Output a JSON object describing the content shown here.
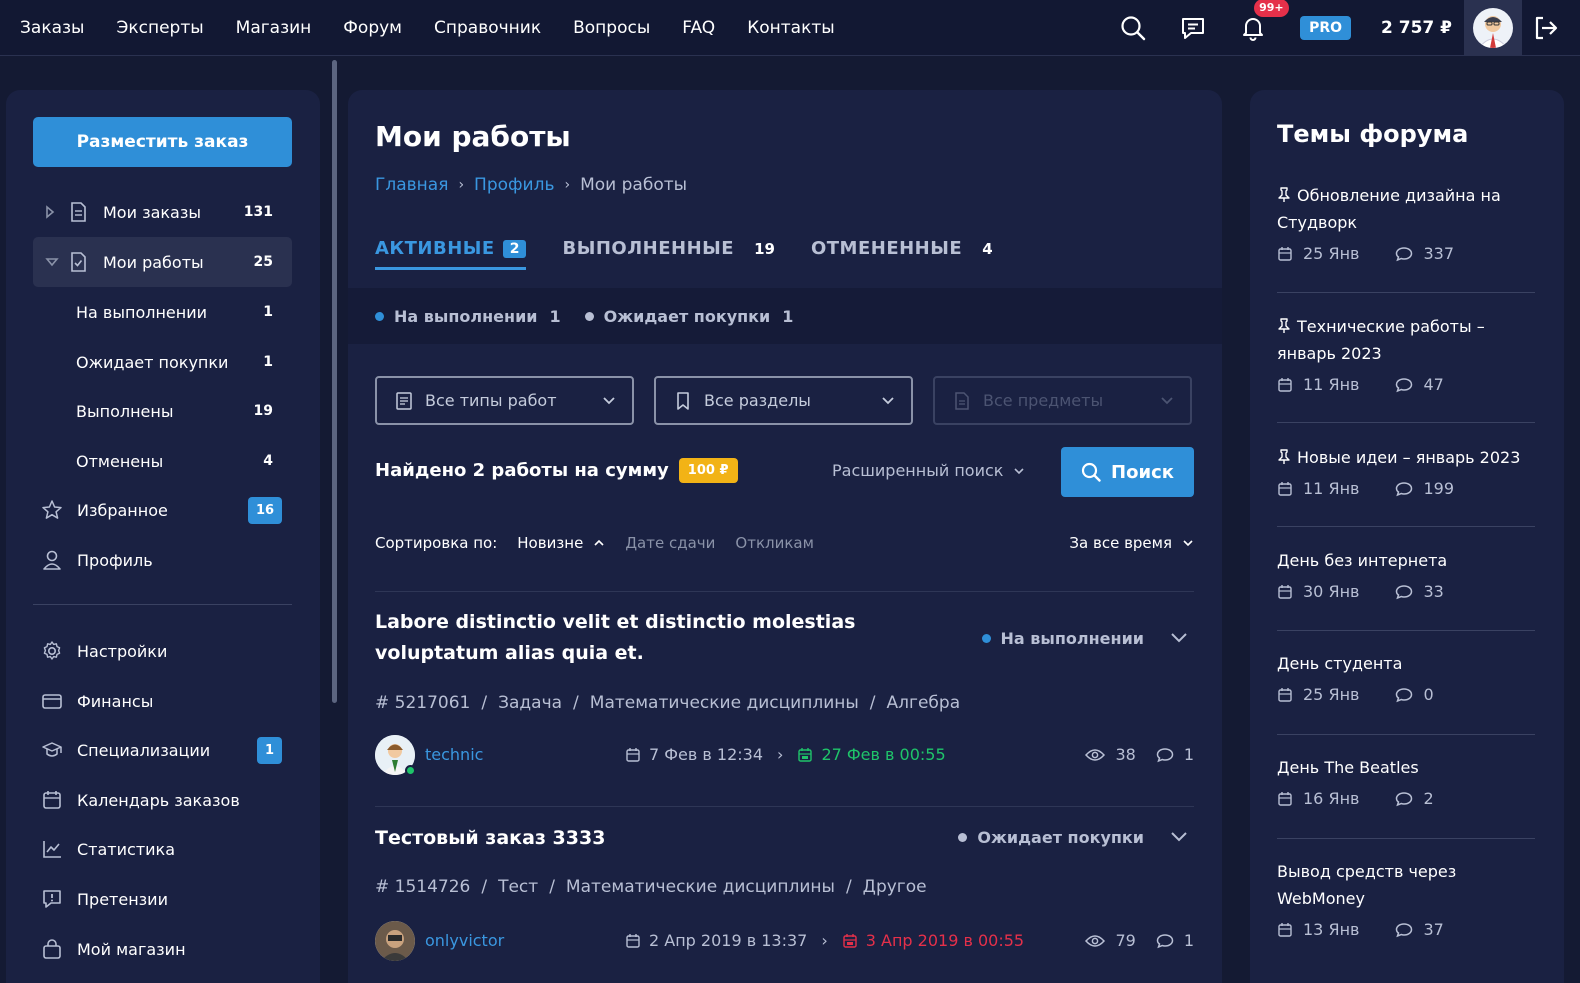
{
  "topbar": {
    "nav": [
      "Заказы",
      "Эксперты",
      "Магазин",
      "Форум",
      "Справочник",
      "Вопросы",
      "FAQ",
      "Контакты"
    ],
    "notifications_badge": "99+",
    "pro_label": "PRO",
    "balance": "2 757 ₽",
    "icons": [
      "search-icon",
      "chat-icon",
      "bell-icon",
      "avatar",
      "logout-icon"
    ]
  },
  "sidebar": {
    "post_button": "Разместить заказ",
    "items": [
      {
        "label": "Мои заказы",
        "count": "131"
      },
      {
        "label": "Мои работы",
        "count": "25"
      },
      {
        "label": "На выполнении",
        "count": "1"
      },
      {
        "label": "Ожидает покупки",
        "count": "1"
      },
      {
        "label": "Выполнены",
        "count": "19"
      },
      {
        "label": "Отменены",
        "count": "4"
      },
      {
        "label": "Избранное",
        "count": "16"
      },
      {
        "label": "Профиль",
        "count": ""
      },
      {
        "label": "Настройки",
        "count": ""
      },
      {
        "label": "Финансы",
        "count": ""
      },
      {
        "label": "Специализации",
        "count": "1"
      },
      {
        "label": "Календарь заказов",
        "count": ""
      },
      {
        "label": "Статистика",
        "count": ""
      },
      {
        "label": "Претензии",
        "count": ""
      },
      {
        "label": "Мой магазин",
        "count": ""
      }
    ]
  },
  "main": {
    "title": "Мои работы",
    "breadcrumb": [
      "Главная",
      "Профиль",
      "Мои работы"
    ],
    "tabs": [
      {
        "label": "АКТИВНЫЕ",
        "count": "2"
      },
      {
        "label": "ВЫПОЛНЕННЫЕ",
        "count": "19"
      },
      {
        "label": "ОТМЕНЕННЫЕ",
        "count": "4"
      }
    ],
    "status_filters": [
      {
        "label": "На выполнении",
        "count": "1",
        "color": "#2f8fd8"
      },
      {
        "label": "Ожидает покупки",
        "count": "1",
        "color": "#b8bfd4"
      }
    ],
    "filters": [
      "Все типы работ",
      "Все разделы",
      "Все предметы"
    ],
    "found_text": "Найдено 2 работы на сумму",
    "found_sum": "100 ₽",
    "advanced_search": "Расширенный поиск",
    "search_button": "Поиск",
    "sort_label": "Сортировка по:",
    "sort_options": [
      "Новизне",
      "Дате сдачи",
      "Откликам"
    ],
    "period": "За все время",
    "orders": [
      {
        "title": "Labore distinctio velit et distinctio molestias voluptatum alias quia et.",
        "status": "На выполнении",
        "status_color": "#2f8fd8",
        "id": "# 5217061",
        "type": "Задача",
        "section": "Математические дисциплины",
        "subject": "Алгебра",
        "user": "technic",
        "date_from": "7 Фев в 12:34",
        "date_to": "27 Фев в 00:55",
        "views": "38",
        "comments": "1"
      },
      {
        "title": "Тестовый заказ 3333",
        "status": "Ожидает покупки",
        "status_color": "#b8bfd4",
        "id": "# 1514726",
        "type": "Тест",
        "section": "Математические дисциплины",
        "subject": "Другое",
        "user": "onlyvictor",
        "date_from": "2 Апр 2019 в 13:37",
        "date_to": "3 Апр 2019 в 00:55",
        "views": "79",
        "comments": "1"
      }
    ]
  },
  "forum": {
    "title": "Темы форума",
    "topics": [
      {
        "title": "Обновление дизайна на Студворк",
        "date": "25 Янв",
        "comments": "337",
        "pinned": true
      },
      {
        "title": "Технические работы – январь 2023",
        "date": "11 Янв",
        "comments": "47",
        "pinned": true
      },
      {
        "title": "Новые идеи – январь 2023",
        "date": "11 Янв",
        "comments": "199",
        "pinned": true
      },
      {
        "title": "День без интернета",
        "date": "30 Янв",
        "comments": "33",
        "pinned": false
      },
      {
        "title": "День студента",
        "date": "25 Янв",
        "comments": "0",
        "pinned": false
      },
      {
        "title": "День The Beatles",
        "date": "16 Янв",
        "comments": "2",
        "pinned": false
      },
      {
        "title": "Вывод средств через WebMoney",
        "date": "13 Янв",
        "comments": "37",
        "pinned": false
      }
    ]
  },
  "colors": {
    "accent": "#2f8fd8",
    "link": "#3a97e0",
    "badge_red": "#e5304a",
    "badge_yellow": "#f2b316",
    "green": "#1fc46a",
    "bg": "#141a33",
    "panel": "#1a2142"
  }
}
